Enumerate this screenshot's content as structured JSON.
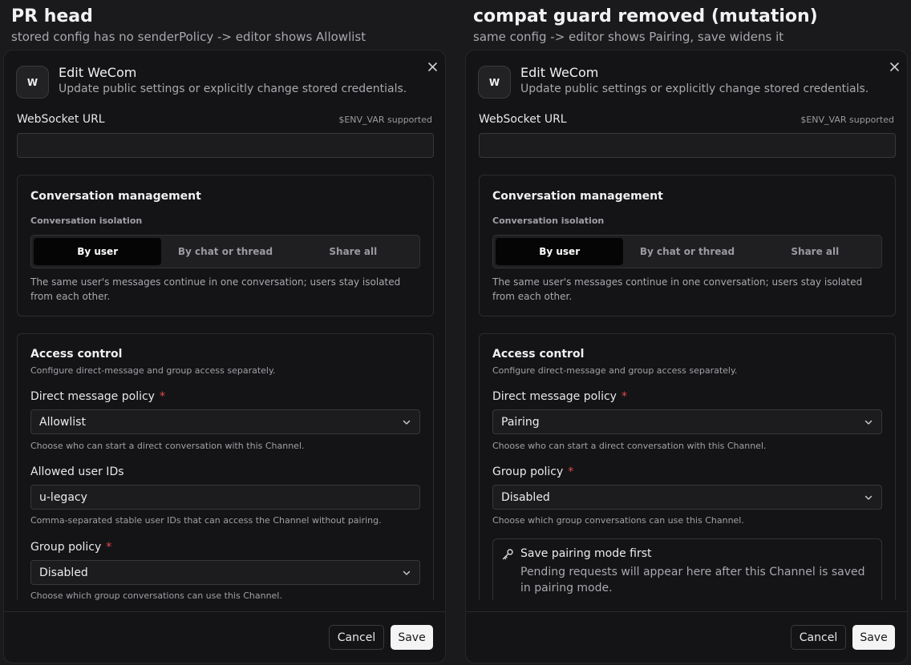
{
  "panels": [
    {
      "title": "PR head",
      "subtitle": "stored config has no senderPolicy -> editor shows Allowlist",
      "dialog": {
        "avatar": "W",
        "title": "Edit WeCom",
        "description": "Update public settings or explicitly change stored credentials.",
        "websocket_label": "WebSocket URL",
        "env_hint": "$ENV_VAR supported",
        "websocket_value": "",
        "conversation": {
          "title": "Conversation management",
          "isolation_label": "Conversation isolation",
          "options": [
            "By user",
            "By chat or thread",
            "Share all"
          ],
          "selected": "By user",
          "description": "The same user's messages continue in one conversation; users stay isolated from each other."
        },
        "access": {
          "title": "Access control",
          "subtitle": "Configure direct-message and group access separately.",
          "dm_policy_label": "Direct message policy",
          "dm_policy_value": "Allowlist",
          "dm_policy_help": "Choose who can start a direct conversation with this Channel.",
          "allowed_ids_label": "Allowed user IDs",
          "allowed_ids_value": "u-legacy",
          "allowed_ids_help": "Comma-separated stable user IDs that can access the Channel without pairing.",
          "group_policy_label": "Group policy",
          "group_policy_value": "Disabled",
          "group_policy_help": "Choose which group conversations can use this Channel."
        },
        "required_mark": "*",
        "cancel_label": "Cancel",
        "save_label": "Save"
      }
    },
    {
      "title": "compat guard removed (mutation)",
      "subtitle": "same config -> editor shows Pairing, save widens it",
      "dialog": {
        "avatar": "W",
        "title": "Edit WeCom",
        "description": "Update public settings or explicitly change stored credentials.",
        "websocket_label": "WebSocket URL",
        "env_hint": "$ENV_VAR supported",
        "websocket_value": "",
        "conversation": {
          "title": "Conversation management",
          "isolation_label": "Conversation isolation",
          "options": [
            "By user",
            "By chat or thread",
            "Share all"
          ],
          "selected": "By user",
          "description": "The same user's messages continue in one conversation; users stay isolated from each other."
        },
        "access": {
          "title": "Access control",
          "subtitle": "Configure direct-message and group access separately.",
          "dm_policy_label": "Direct message policy",
          "dm_policy_value": "Pairing",
          "dm_policy_help": "Choose who can start a direct conversation with this Channel.",
          "group_policy_label": "Group policy",
          "group_policy_value": "Disabled",
          "group_policy_help": "Choose which group conversations can use this Channel.",
          "notice_title": "Save pairing mode first",
          "notice_body": "Pending requests will appear here after this Channel is saved in pairing mode."
        },
        "required_mark": "*",
        "cancel_label": "Cancel",
        "save_label": "Save"
      }
    }
  ],
  "icons": {
    "close": "close-icon",
    "chevron": "chevron-down-icon",
    "key": "key-icon"
  },
  "colors": {
    "background": "#1a1a1c",
    "dialog": "#141416",
    "required": "#e5484d",
    "save_button": "#f4f4f5",
    "segment_active": "#050505"
  }
}
